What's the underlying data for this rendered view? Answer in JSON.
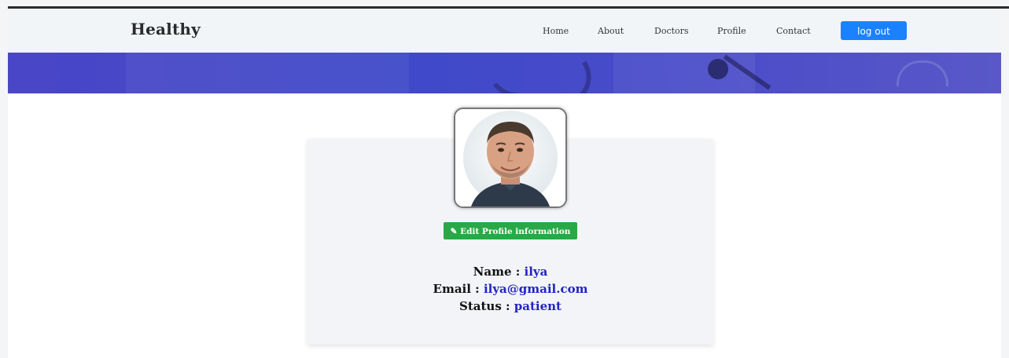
{
  "navbar": {
    "brand": "Healthy",
    "links": [
      "Home",
      "About",
      "Doctors",
      "Profile",
      "Contact"
    ],
    "logout_label": "log out"
  },
  "profile": {
    "avatar_icon": "user-avatar-photo",
    "edit_icon": "edit-icon",
    "edit_label": "Edit Profile information",
    "name_label": "Name :",
    "name_value": "ilya",
    "email_label": "Email :",
    "email_value": "ilya@gmail.com",
    "status_label": "Status :",
    "status_value": "patient"
  },
  "colors": {
    "banner": "#4a46c8",
    "logout_button": "#1a82ff",
    "edit_button": "#29a847",
    "value_text": "#2323c4"
  }
}
